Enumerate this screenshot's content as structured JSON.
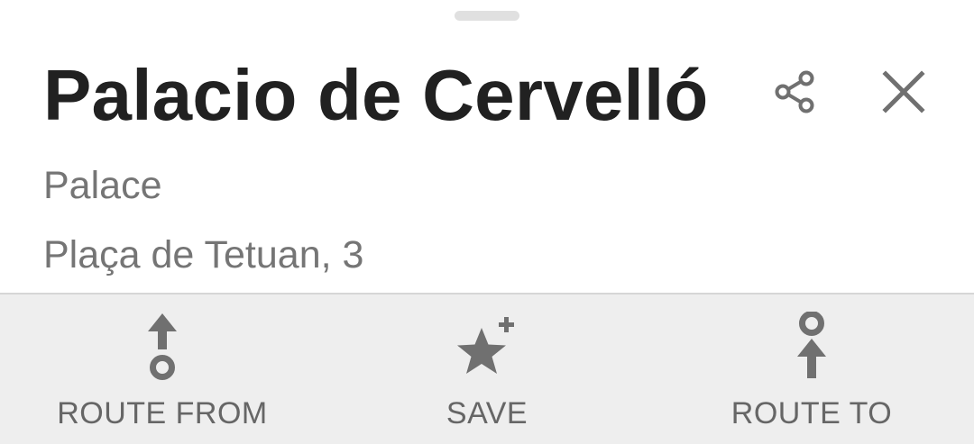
{
  "place": {
    "title": "Palacio de Cervelló",
    "category": "Palace",
    "address": "Plaça de Tetuan, 3"
  },
  "header_icons": {
    "share": "share-icon",
    "close": "close-icon"
  },
  "actions": [
    {
      "label": "ROUTE FROM",
      "icon": "route-from-icon"
    },
    {
      "label": "SAVE",
      "icon": "star-plus-icon"
    },
    {
      "label": "ROUTE TO",
      "icon": "route-to-icon"
    }
  ],
  "colors": {
    "title": "#212121",
    "secondary_text": "#757575",
    "icon": "#707070",
    "action_bar_bg": "#eeeeee",
    "divider": "#d6d6d6"
  }
}
